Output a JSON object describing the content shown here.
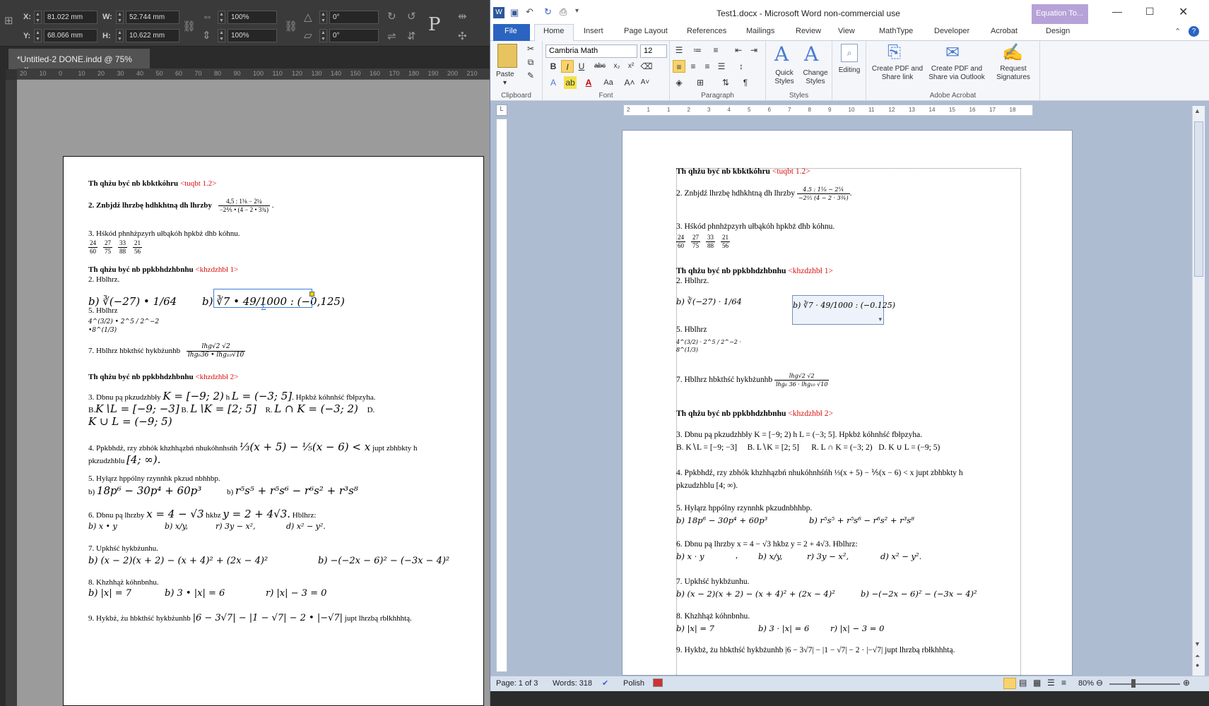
{
  "indesign": {
    "control": {
      "x_label": "X:",
      "x_value": "81.022 mm",
      "y_label": "Y:",
      "y_value": "68.066 mm",
      "w_label": "W:",
      "w_value": "52.744 mm",
      "h_label": "H:",
      "h_value": "10.622 mm",
      "scale_x": "100%",
      "scale_y": "100%",
      "angle": "0°",
      "shear": "0°"
    },
    "tab_title": "*Untitled-2 DONE.indd @ 75%",
    "tab_close": "×",
    "ruler": [
      "20",
      "10",
      "0",
      "10",
      "20",
      "30",
      "40",
      "50",
      "60",
      "70",
      "80",
      "90",
      "100",
      "110",
      "120",
      "130",
      "140",
      "150",
      "160",
      "170",
      "180",
      "190",
      "200",
      "210"
    ],
    "doc": {
      "h1": "Th qhżu być nb kbktkóhru",
      "h1_tag": "<tuqbt 1.2>",
      "l2": "2. Znbjdź lhrzbę hdhkhtną dh lhrzby",
      "l2_num": "4,5 : 1⅛ − 2¼",
      "l2_den": "−2⅖ • (4 − 2 • 3¾)",
      "l3": "3. Hśkód phnhżpzyrh ułbąkóh hpkbż dhb kóhnu.",
      "fracs": [
        [
          "24",
          "60"
        ],
        [
          "27",
          "75"
        ],
        [
          "33",
          "88"
        ],
        [
          "21",
          "56"
        ]
      ],
      "h2": "Th qhżu być nb ppkbhdzhbnhu",
      "h2_tag": "<khzdzhbł 1>",
      "l4": "2. Hblhrz.",
      "l4a": "b) ∛(−27) • 1/64",
      "l4b": "b) ∛7 • 49/1000 : (−0,125)",
      "l5": "5. Hblhrz",
      "l5f": "4^(3/2) • 2^5 / 2^−2 •8^(1/3)",
      "l7": "7. Hblhrz hbkthść hykbżunhb",
      "l7_num": "lhg√2 √2",
      "l7_den": "lhg₆36 • lhg₁₀√10",
      "h3": "Th qhżu być nb ppkbhdzhbnhu",
      "h3_tag": "<khzdzhbł 2>",
      "l8a": "3. Dbnu pą pkzudzhbły",
      "l8m": "K = [−9; 2)",
      "l8h": "h",
      "l8m2": "L = (−3; 5]",
      "l8e": ". Hpkbż kóhnhść fbłpzyha.",
      "l8b1": "B.",
      "l8b1m": "K∖L = [−9; −3]",
      "l8b2": "B.",
      "l8b2m": "L∖K = [2; 5]",
      "l8b3": "R.",
      "l8b3m": "L ∩ K = (−3; 2)",
      "l8b4": "D.",
      "l8b4m": "K ∪ L = (−9; 5)",
      "l9": "4. Ppkbhdź, rzy zbhók khzhhązbń nhukóhnhsńh",
      "l9m": "⅓(x + 5) − ⅕(x − 6) < x",
      "l9e": "jupt zbhbkty h",
      "l9b": "pkzudzhblu",
      "l9bm": "[4; ∞).",
      "l10": "5. Hyłąrz hppólny rzynnhk pkzud nbhhbp.",
      "l10a": "b)",
      "l10am": "18p⁶ − 30p⁴ + 60p³",
      "l10b": "b)",
      "l10bm": "r⁵s⁵ + r⁵s⁶ − r⁶s² + r³s⁸",
      "l11": "6. Dbnu pą lhrzby",
      "l11m": "x = 4 − √3",
      "l11h": "hkbz",
      "l11m2": "y = 2 + 4√3.",
      "l11e": "Hblhrz:",
      "l11a": "b) x • y",
      "l11b": "b) x/y,",
      "l11c": "r) 3y − x²,",
      "l11d": "d) x² − y².",
      "l12": "7. Upkhść hykbżunhu.",
      "l12a": "b) (x − 2)(x + 2) − (x + 4)² + (2x − 4)²",
      "l12b": "b) −(−2x − 6)² − (−3x − 4)²",
      "l13": "8. Khzhhąż kóhnbnhu.",
      "l13a": "b) |x| = 7",
      "l13b": "b) 3 • |x| = 6",
      "l13c": "r) |x| − 3 = 0",
      "l14": "9. Hykbż, żu hbkthść hykbżunhb",
      "l14m": "|6 − 3√7| − |1 − √7| − 2 • |−√7|",
      "l14e": "jupt lhrzbą rbłkhhhtą."
    }
  },
  "word": {
    "title": "Test1.docx  -  Microsoft Word non-commercial use",
    "context_tab": "Equation To...",
    "tabs": [
      "File",
      "Home",
      "Insert",
      "Page Layout",
      "References",
      "Mailings",
      "Review",
      "View",
      "MathType",
      "Developer",
      "Acrobat",
      "Design"
    ],
    "font": "Cambria Math",
    "size": "12",
    "groups": {
      "clipboard": "Clipboard",
      "font": "Font",
      "paragraph": "Paragraph",
      "styles": "Styles",
      "acrobat": "Adobe Acrobat"
    },
    "buttons": {
      "paste": "Paste",
      "quick_styles": "Quick Styles",
      "change_styles": "Change Styles",
      "editing": "Editing",
      "pdf_link": "Create PDF and Share link",
      "pdf_outlook": "Create PDF and Share via Outlook",
      "signatures": "Request Signatures"
    },
    "ruler": [
      "2",
      "1",
      "1",
      "2",
      "3",
      "4",
      "5",
      "6",
      "7",
      "8",
      "9",
      "10",
      "11",
      "12",
      "13",
      "14",
      "15",
      "16",
      "17",
      "18"
    ],
    "status": {
      "page": "Page: 1 of 3",
      "words": "Words: 318",
      "lang": "Polish",
      "zoom": "80%"
    },
    "doc": {
      "h1": "Th qhżu być nb kbktkóhru",
      "h1_tag": "<tuqbt 1.2>",
      "l2": "2. Znbjdź lhrzbę hdhkhtną dh lhrzby",
      "l2_num": "4.5 : 1⅛ − 2¼",
      "l2_den": "−2⅖ (4 − 2 · 3¾)",
      "l3": "3. Hśkód phnhżpzyrh ułbąkóh hpkbż dhb kóhnu.",
      "fracs": [
        [
          "24",
          "60"
        ],
        [
          "27",
          "75"
        ],
        [
          "33",
          "88"
        ],
        [
          "21",
          "56"
        ]
      ],
      "h2": "Th qhżu być nb ppkbhdzhbnhu",
      "h2_tag": "<khzdzhbł 1>",
      "l4": "2. Hblhrz.",
      "l4a": "b) ∛(−27) · 1/64",
      "l4b": "b) ∛7 · 49/1000 : (−0.125)",
      "l5": "5. Hblhrz",
      "l5f": "4^(3/2) · 2^5 / 2^−2 · 8^(1/3)",
      "l7": "7. Hblhrz hbkthść hykbżunhb",
      "l7_num": "lhg√2 √2",
      "l7_den": "lhg₆ 36 · lhg₁₀ √10",
      "h3": "Th qhżu być nb ppkbhdzhbnhu",
      "h3_tag": "<khzdzhbł 2>",
      "l8": "3. Dbnu pą pkzudzhbły K = [−9; 2) h L = (−3; 5]. Hpkbż kóhnhść fbłpzyha.",
      "l8b": "B. K∖L = [−9; −3]     B. L∖K = [2; 5]      R. L ∩ K = (−3; 2)   D. K ∪ L = (−9; 5)",
      "l9": "4. Ppkbhdź, rzy zbhók khzhhązbń nhukóhnhśńh ⅓(x + 5) − ⅕(x − 6) < x jupt zbhbkty h",
      "l9b": "pkzudzhblu [4; ∞).",
      "l10": "5. Hyłąrz hppólny rzynnhk pkzudnbhhbp.",
      "l10a": "b) 18p⁶ − 30p⁴ + 60p³",
      "l10b": "b) r⁵s⁵ + r⁵s⁶ − r⁶s² + r³s⁸",
      "l11": "6. Dbnu pą lhrzby x = 4 − √3 hkbz y = 2 + 4√3. Hblhrz:",
      "l11a": "b) x · y",
      "l11a2": ",",
      "l11b": "b) x/y,",
      "l11c": "r) 3y − x²,",
      "l11d": "d) x² − y².",
      "l12": "7. Upkhść hykbżunhu.",
      "l12a": "b) (x − 2)(x + 2) − (x + 4)² + (2x − 4)²",
      "l12b": "b) −(−2x − 6)² − (−3x − 4)²",
      "l13": "8. Khzhhąż kóhnbnhu.",
      "l13a": "b) |x| = 7",
      "l13b": "b) 3 · |x| = 6",
      "l13c": "r) |x| − 3 = 0",
      "l14": "9. Hykbż, żu hbkthść hykbżunhb |6 − 3√7| − |1 − √7| − 2 · |−√7| jupt lhrzbą rbłkhhhtą."
    }
  }
}
